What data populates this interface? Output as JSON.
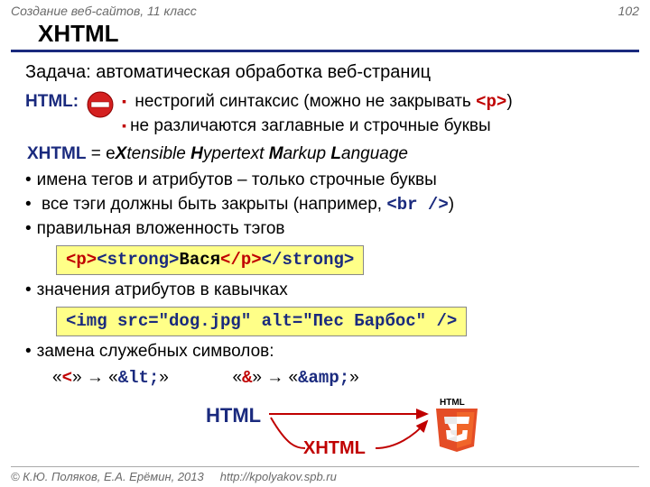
{
  "header": {
    "course": "Создание веб-сайтов, 11 класс",
    "page": "102"
  },
  "title": "XHTML",
  "task": "Задача: автоматическая обработка веб-страниц",
  "htmlRow": {
    "label": "HTML:",
    "pt1_a": "нестрогий синтаксис (можно не закрывать ",
    "pt1_b": "<p>",
    "pt1_c": ")",
    "pt2": "не различаются заглавные и строчные буквы"
  },
  "xhtmlDef": {
    "lead": "XHTML",
    "eq": " = e",
    "x": "X",
    "t1": "tensible ",
    "h": "H",
    "t2": "ypertext ",
    "m": "M",
    "t3": "arkup ",
    "l": "L",
    "t4": "anguage"
  },
  "rules": {
    "r1": "имена тегов и атрибутов – только строчные буквы",
    "r2_a": "все тэги должны быть закрыты (например, ",
    "r2_b": "<br />",
    "r2_c": ")",
    "r3": "правильная вложенность тэгов",
    "r4": "значения атрибутов в кавычках",
    "r5": "замена служебных символов:"
  },
  "code1": {
    "p_open": "<p>",
    "s_open": "<strong>",
    "text": "Вася",
    "p_close": "</p>",
    "s_close": "</strong>"
  },
  "code2": {
    "lt": "<",
    "tag": "img",
    "attrs": " src=\"dog.jpg\" alt=\"Пес Барбос\" ",
    "slash": "/>",
    "full": "<img src=\"dog.jpg\" alt=\"Пес Барбос\" />"
  },
  "ent": {
    "q1a": "«",
    "lt": "<",
    "q1b": "» → «",
    "ltEnt": "&lt;",
    "q1c": "»",
    "q2a": "«",
    "amp": "&",
    "q2b": "» → «",
    "ampEnt": "&amp;",
    "q2c": "»"
  },
  "diagram": {
    "html": "HTML",
    "xhtml": "XHTML",
    "logoLabel": "HTML"
  },
  "footer": {
    "copy": "© К.Ю. Поляков, Е.А. Ерёмин, 2013",
    "url": "http://kpolyakov.spb.ru"
  }
}
